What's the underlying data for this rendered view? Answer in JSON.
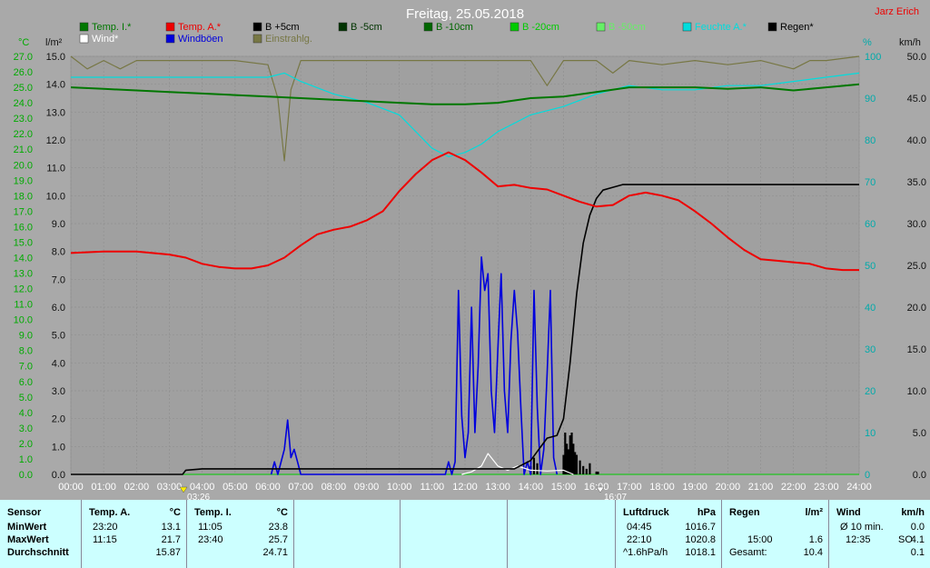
{
  "header": {
    "title": "Freitag, 25.05.2018",
    "author": "Jarz Erich"
  },
  "axes": {
    "left1_unit": "°C",
    "left2_unit": "l/m²",
    "right1_unit": "%",
    "right2_unit": "km/h",
    "temp_ticks": [
      "27.0",
      "26.0",
      "25.0",
      "24.0",
      "23.0",
      "22.0",
      "21.0",
      "20.0",
      "19.0",
      "18.0",
      "17.0",
      "16.0",
      "15.0",
      "14.0",
      "13.0",
      "12.0",
      "11.0",
      "10.0",
      "9.0",
      "8.0",
      "7.0",
      "6.0",
      "5.0",
      "4.0",
      "3.0",
      "2.0",
      "1.0",
      "0.0"
    ],
    "rain_ticks": [
      "15.0",
      "14.0",
      "13.0",
      "12.0",
      "11.0",
      "10.0",
      "9.0",
      "8.0",
      "7.0",
      "6.0",
      "5.0",
      "4.0",
      "3.0",
      "2.0",
      "1.0",
      "0.0"
    ],
    "hum_ticks": [
      "100",
      "90",
      "80",
      "70",
      "60",
      "50",
      "40",
      "30",
      "20",
      "10",
      "0"
    ],
    "wind_ticks": [
      "50.0",
      "45.0",
      "40.0",
      "35.0",
      "30.0",
      "25.0",
      "20.0",
      "15.0",
      "10.0",
      "5.0",
      "0.0"
    ],
    "time_ticks": [
      "00:00",
      "01:00",
      "02:00",
      "03:00",
      "04:00",
      "05:00",
      "06:00",
      "07:00",
      "08:00",
      "09:00",
      "10:00",
      "11:00",
      "12:00",
      "13:00",
      "14:00",
      "15:00",
      "16:00",
      "17:00",
      "18:00",
      "19:00",
      "20:00",
      "21:00",
      "22:00",
      "23:00",
      "24:00"
    ],
    "markers": [
      {
        "label": "03:26",
        "color": "#ffee00"
      },
      {
        "label": "16:07",
        "color": "#ffffff"
      }
    ]
  },
  "legend": [
    {
      "label": "Temp. I.*",
      "color": "#007700"
    },
    {
      "label": "Temp. A.*",
      "color": "#ee0000"
    },
    {
      "label": "B +5cm",
      "color": "#000000"
    },
    {
      "label": "B -5cm",
      "color": "#003300"
    },
    {
      "label": "B -10cm",
      "color": "#006600"
    },
    {
      "label": "B -20cm",
      "color": "#00cc00"
    },
    {
      "label": "B -50cm",
      "color": "#66ee66"
    },
    {
      "label": "Feuchte A.*",
      "color": "#00dddd"
    },
    {
      "label": "Regen*",
      "color": "#000000"
    },
    {
      "label": "Wind*",
      "color": "#ffffff"
    },
    {
      "label": "Windböen",
      "color": "#0000dd"
    },
    {
      "label": "Einstrahlg.",
      "color": "#777744"
    }
  ],
  "chart_data": {
    "type": "line",
    "title": "Freitag, 25.05.2018",
    "x_unit": "hours",
    "xlim": [
      0,
      24
    ],
    "ylim_temp": [
      0,
      27
    ],
    "ylim_rain": [
      0,
      15
    ],
    "ylim_humidity": [
      0,
      100
    ],
    "ylim_wind": [
      0,
      50
    ],
    "series": [
      {
        "name": "Temp. I.*",
        "axis": "temp",
        "color": "#007700",
        "x": [
          0,
          1,
          2,
          3,
          4,
          5,
          6,
          7,
          8,
          9,
          10,
          11,
          12,
          13,
          14,
          15,
          16,
          17,
          18,
          19,
          20,
          21,
          22,
          23,
          24
        ],
        "values": [
          25.0,
          24.9,
          24.8,
          24.7,
          24.6,
          24.5,
          24.4,
          24.3,
          24.2,
          24.1,
          24.0,
          23.9,
          23.9,
          24.0,
          24.3,
          24.4,
          24.7,
          25.0,
          25.0,
          25.0,
          24.9,
          25.0,
          24.8,
          25.0,
          25.2
        ]
      },
      {
        "name": "Temp. A.*",
        "axis": "temp",
        "color": "#ee0000",
        "x": [
          0,
          1,
          2,
          3,
          3.5,
          4,
          4.5,
          5,
          5.5,
          6,
          6.5,
          7,
          7.5,
          8,
          8.5,
          9,
          9.5,
          10,
          10.5,
          11,
          11.5,
          12,
          12.5,
          13,
          13.5,
          14,
          14.5,
          15,
          15.5,
          16,
          16.5,
          17,
          17.5,
          18,
          18.5,
          19,
          19.5,
          20,
          20.5,
          21,
          21.5,
          22,
          22.5,
          23,
          23.5,
          24
        ],
        "values": [
          14.3,
          14.4,
          14.4,
          14.2,
          14.0,
          13.6,
          13.4,
          13.3,
          13.3,
          13.5,
          14.0,
          14.8,
          15.5,
          15.8,
          16.0,
          16.4,
          17.0,
          18.3,
          19.4,
          20.3,
          20.8,
          20.3,
          19.5,
          18.6,
          18.7,
          18.5,
          18.4,
          18.0,
          17.6,
          17.3,
          17.4,
          18.0,
          18.2,
          18.0,
          17.7,
          17.0,
          16.2,
          15.3,
          14.5,
          13.9,
          13.8,
          13.7,
          13.6,
          13.3,
          13.2,
          13.2
        ]
      },
      {
        "name": "Feuchte A.*",
        "axis": "humidity",
        "color": "#00dddd",
        "x": [
          0,
          1,
          2,
          3,
          4,
          5,
          6,
          6.5,
          7,
          8,
          9,
          10,
          10.5,
          11,
          11.5,
          12,
          12.5,
          13,
          13.5,
          14,
          15,
          16,
          17,
          18,
          19,
          20,
          21,
          22,
          23,
          24
        ],
        "values": [
          95,
          95,
          95,
          95,
          95,
          95,
          95,
          96,
          94,
          91,
          89,
          86,
          82,
          78,
          76,
          77,
          79,
          82,
          84,
          86,
          88,
          91,
          93,
          92,
          92,
          93,
          93,
          94,
          95,
          96
        ]
      },
      {
        "name": "Regen*",
        "axis": "rain",
        "color": "#000000",
        "x": [
          0,
          3.4,
          3.5,
          4,
          5,
          6,
          7,
          8,
          9,
          10,
          11,
          12,
          13,
          13.5,
          14,
          14.5,
          14.8,
          15,
          15.2,
          15.4,
          15.6,
          15.8,
          16,
          16.2,
          16.5,
          16.8,
          17,
          17.5,
          18,
          20,
          22,
          24
        ],
        "values": [
          0,
          0,
          0.15,
          0.2,
          0.2,
          0.2,
          0.2,
          0.2,
          0.2,
          0.2,
          0.2,
          0.2,
          0.2,
          0.2,
          0.5,
          1.3,
          1.4,
          2.0,
          4.0,
          6.5,
          8.3,
          9.3,
          9.9,
          10.2,
          10.3,
          10.4,
          10.4,
          10.4,
          10.4,
          10.4,
          10.4,
          10.4
        ]
      },
      {
        "name": "Windböen",
        "axis": "wind",
        "color": "#0000dd",
        "x": [
          6.1,
          6.2,
          6.3,
          6.4,
          6.5,
          6.6,
          6.7,
          6.8,
          6.9,
          7.0,
          11.4,
          11.5,
          11.6,
          11.7,
          11.8,
          11.9,
          12.0,
          12.1,
          12.2,
          12.3,
          12.4,
          12.5,
          12.6,
          12.7,
          12.8,
          12.9,
          13.0,
          13.1,
          13.2,
          13.3,
          13.4,
          13.5,
          13.6,
          13.7,
          13.8,
          13.9,
          14.0,
          14.1,
          14.2,
          14.3,
          14.4,
          14.5,
          14.6,
          14.7,
          14.8
        ],
        "values": [
          0,
          1.5,
          0,
          1.5,
          3,
          6.5,
          2,
          3,
          1.5,
          0,
          0,
          1.5,
          0,
          1.5,
          22,
          7,
          2,
          5,
          20,
          5,
          13,
          26,
          22,
          24,
          10,
          5,
          15,
          24,
          10,
          5,
          16,
          22,
          17,
          8,
          0,
          1.5,
          0,
          22,
          8,
          0,
          3,
          12,
          22,
          2,
          0
        ]
      },
      {
        "name": "Wind*",
        "axis": "wind",
        "color": "#ffffff",
        "x": [
          11.9,
          12.2,
          12.5,
          12.7,
          13.0,
          13.3,
          13.6,
          14.0,
          14.5,
          15.0,
          15.3
        ],
        "values": [
          0,
          0.3,
          1,
          2.5,
          1,
          0.5,
          1,
          0.5,
          0.4,
          0.5,
          0
        ]
      },
      {
        "name": "Einstrahlg.",
        "axis": "humidity",
        "color": "#777744",
        "x": [
          0,
          0.5,
          1,
          1.5,
          2,
          3,
          4,
          5,
          6,
          6.3,
          6.5,
          6.7,
          7,
          8,
          9,
          10,
          11,
          12,
          13,
          14,
          14.5,
          15,
          16,
          16.5,
          17,
          18,
          19,
          20,
          21,
          22,
          22.5,
          23,
          24
        ],
        "values": [
          100,
          97,
          99,
          97,
          99,
          99,
          99,
          99,
          98,
          90,
          75,
          92,
          99,
          99,
          99,
          99,
          99,
          99,
          99,
          99,
          93,
          99,
          99,
          96,
          99,
          98,
          99,
          98,
          99,
          97,
          99,
          99,
          100
        ]
      }
    ],
    "rain_bars": {
      "x": [
        14.0,
        14.1,
        14.2,
        15.0,
        15.05,
        15.1,
        15.15,
        15.2,
        15.25,
        15.3,
        15.35,
        15.4,
        15.5,
        15.6,
        15.7,
        15.8,
        16.0,
        16.05
      ],
      "values": [
        0.3,
        0.6,
        0.4,
        0.7,
        1.5,
        1.1,
        0.9,
        1.4,
        1.5,
        1.1,
        0.8,
        0.7,
        0.5,
        0.3,
        0.2,
        0.4,
        0.1,
        0.1
      ]
    }
  },
  "stats": {
    "sensor": {
      "label": "Sensor",
      "rows": [
        "MinWert",
        "MaxWert",
        "Durchschnitt"
      ]
    },
    "temp_a": {
      "label": "Temp. A.",
      "unit": "°C",
      "min_time": "23:20",
      "min_val": "13.1",
      "max_time": "11:15",
      "max_val": "21.7",
      "avg": "15.87"
    },
    "temp_i": {
      "label": "Temp. I.",
      "unit": "°C",
      "min_time": "11:05",
      "min_val": "23.8",
      "max_time": "23:40",
      "max_val": "25.7",
      "avg": "24.71"
    },
    "pressure": {
      "label": "Luftdruck",
      "unit": "hPa",
      "min_time": "04:45",
      "min_val": "1016.7",
      "max_time": "22:10",
      "max_val": "1020.8",
      "trend": "^1.6hPa/h",
      "avg": "1018.1"
    },
    "rain": {
      "label": "Regen",
      "unit": "l/m²",
      "time": "15:00",
      "val": "1.6",
      "total_label": "Gesamt:",
      "total": "10.4"
    },
    "wind": {
      "label": "Wind",
      "unit": "km/h",
      "avg_label": "Ø 10 min.",
      "avg_val": "0.0",
      "max_time": "12:35",
      "max_dir": "SO",
      "max_val": "4.1",
      "mean": "0.1"
    }
  }
}
